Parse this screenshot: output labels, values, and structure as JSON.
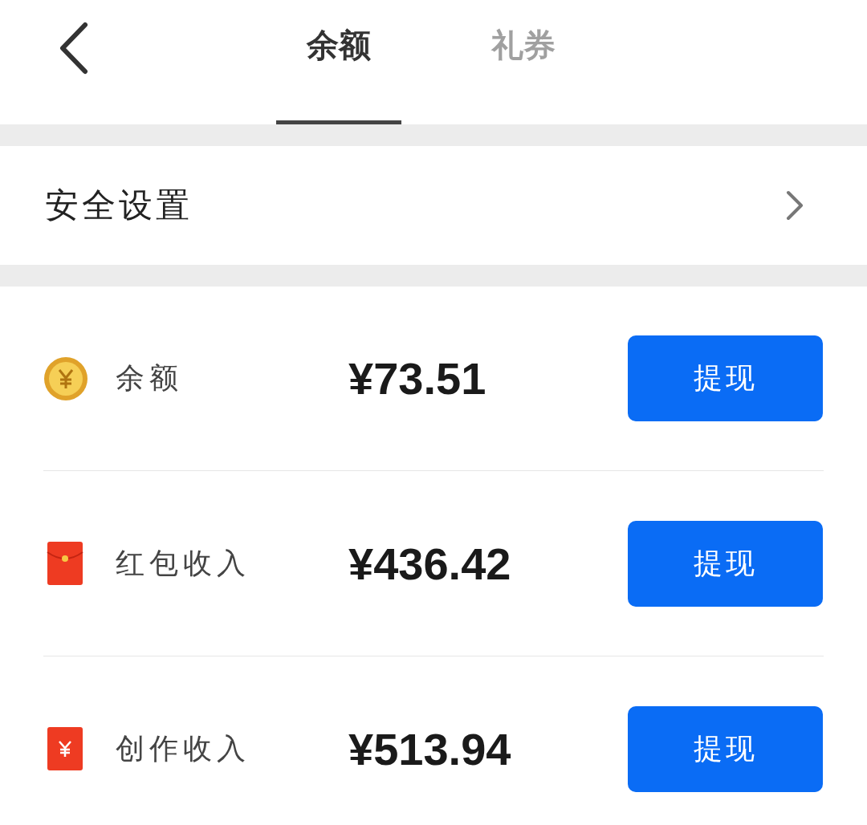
{
  "tabs": [
    {
      "label": "余额",
      "selected": true
    },
    {
      "label": "礼券",
      "selected": false
    }
  ],
  "security": {
    "label": "安全设置"
  },
  "accounts": [
    {
      "kind": "coin",
      "label": "余额",
      "amount": "¥73.51",
      "button": "提现"
    },
    {
      "kind": "envelope",
      "label": "红包收入",
      "amount": "¥436.42",
      "button": "提现"
    },
    {
      "kind": "envelope-yen",
      "label": "创作收入",
      "amount": "¥513.94",
      "button": "提现"
    }
  ]
}
